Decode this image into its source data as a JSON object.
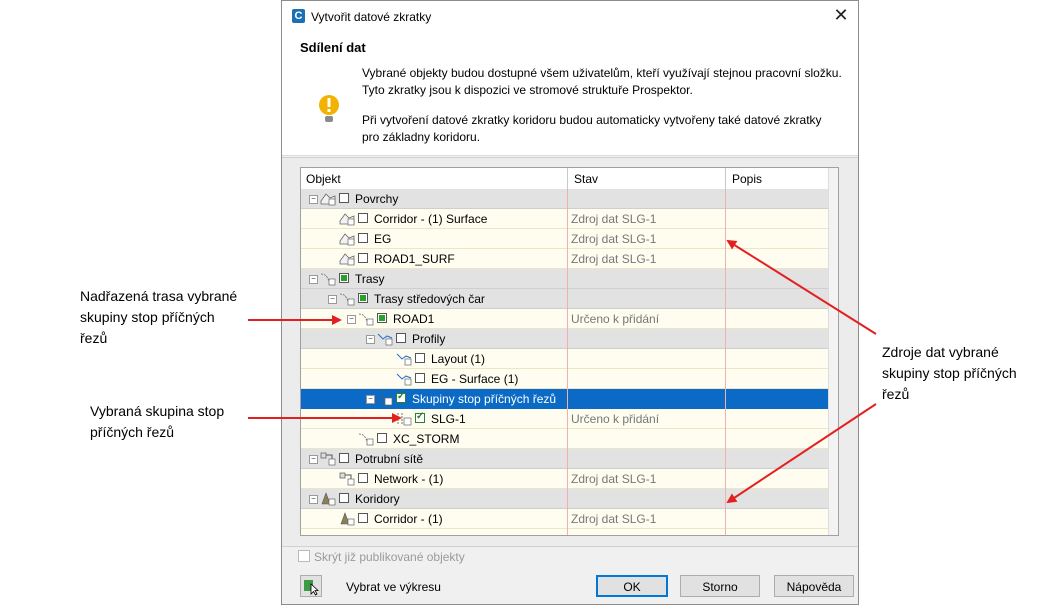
{
  "dialog": {
    "title": "Vytvořit datové zkratky",
    "app_icon_letter": "C",
    "close_glyph": "✕",
    "heading": "Sdílení dat",
    "para1": "Vybrané objekty budou dostupné všem uživatelům, kteří využívají stejnou pracovní složku. Tyto zkratky jsou k dispozici ve stromové struktuře Prospektor.",
    "para2": "Při vytvoření datové zkratky koridoru budou automaticky vytvořeny také datové zkratky pro základny koridoru."
  },
  "grid": {
    "columns": [
      "Objekt",
      "Stav",
      "Popis"
    ],
    "rows": [
      {
        "label": "Povrchy",
        "stav": "",
        "type": "group",
        "indent": 0,
        "check": "none",
        "exp": "−",
        "icon": "surface-icon"
      },
      {
        "label": "Corridor - (1) Surface",
        "stav": "Zdroj dat SLG-1",
        "type": "plain",
        "indent": 1,
        "check": "none",
        "exp": "",
        "icon": "surface-icon"
      },
      {
        "label": "EG",
        "stav": "Zdroj dat SLG-1",
        "type": "plain",
        "indent": 1,
        "check": "none",
        "exp": "",
        "icon": "surface-icon"
      },
      {
        "label": "ROAD1_SURF",
        "stav": "Zdroj dat SLG-1",
        "type": "plain",
        "indent": 1,
        "check": "none",
        "exp": "",
        "icon": "surface-icon"
      },
      {
        "label": "Trasy",
        "stav": "",
        "type": "group",
        "indent": 0,
        "check": "partial",
        "exp": "−",
        "icon": "alignment-icon"
      },
      {
        "label": "Trasy středových čar",
        "stav": "",
        "type": "group",
        "indent": 1,
        "check": "partial",
        "exp": "−",
        "icon": "alignment-icon"
      },
      {
        "label": "ROAD1",
        "stav": "Určeno k přidání",
        "type": "plain",
        "indent": 2,
        "check": "partial",
        "exp": "−",
        "icon": "alignment-icon"
      },
      {
        "label": "Profily",
        "stav": "",
        "type": "group",
        "indent": 3,
        "check": "none",
        "exp": "−",
        "icon": "profile-icon"
      },
      {
        "label": "Layout (1)",
        "stav": "",
        "type": "plain",
        "indent": 4,
        "check": "none",
        "exp": "",
        "icon": "profile-icon"
      },
      {
        "label": "EG - Surface (1)",
        "stav": "",
        "type": "plain",
        "indent": 4,
        "check": "none",
        "exp": "",
        "icon": "profile-icon"
      },
      {
        "label": "Skupiny stop příčných řezů",
        "stav": "",
        "type": "sel",
        "indent": 3,
        "check": "check",
        "exp": "−",
        "icon": "sample-line-icon"
      },
      {
        "label": "SLG-1",
        "stav": "Určeno k přidání",
        "type": "plain",
        "indent": 4,
        "check": "check",
        "exp": "",
        "icon": "sample-line-icon"
      },
      {
        "label": "XC_STORM",
        "stav": "",
        "type": "plain",
        "indent": 2,
        "check": "none",
        "exp": "",
        "icon": "alignment-icon"
      },
      {
        "label": "Potrubní sítě",
        "stav": "",
        "type": "group",
        "indent": 0,
        "check": "none",
        "exp": "−",
        "icon": "pipe-network-icon"
      },
      {
        "label": "Network - (1)",
        "stav": "Zdroj dat SLG-1",
        "type": "plain",
        "indent": 1,
        "check": "none",
        "exp": "",
        "icon": "pipe-network-icon"
      },
      {
        "label": "Koridory",
        "stav": "",
        "type": "group",
        "indent": 0,
        "check": "none",
        "exp": "−",
        "icon": "corridor-icon"
      },
      {
        "label": "Corridor - (1)",
        "stav": "Zdroj dat SLG-1",
        "type": "plain",
        "indent": 1,
        "check": "none",
        "exp": "",
        "icon": "corridor-icon"
      }
    ]
  },
  "footer": {
    "hide_published": "Skrýt již publikované objekty",
    "pick_in_drawing": "Vybrat ve výkresu",
    "ok": "OK",
    "cancel": "Storno",
    "help": "Nápověda"
  },
  "callouts": {
    "parent_alignment": [
      "Nadřazená trasa vybrané",
      "skupiny stop příčných",
      "řezů"
    ],
    "selected_group": [
      "Vybraná skupina stop",
      "příčných řezů"
    ],
    "data_sources": [
      "Zdroje dat vybrané",
      "skupiny stop příčných",
      "řezů"
    ]
  },
  "colors": {
    "selection": "#0b6ac6",
    "arrow": "#e32020",
    "accent": "#0078d7"
  }
}
